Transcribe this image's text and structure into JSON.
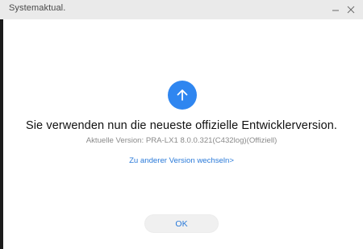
{
  "window": {
    "title": "Systemaktual."
  },
  "icons": {
    "update": "arrow-up-icon",
    "minimize": "minimize-icon",
    "close": "close-icon"
  },
  "main": {
    "headline": "Sie verwenden nun die neueste offizielle Entwicklerversion.",
    "version_text": "Aktuelle Version: PRA-LX1 8.0.0.321(C432log)(Offiziell)",
    "switch_link": "Zu anderer Version wechseln>",
    "ok_label": "OK"
  },
  "colors": {
    "accent": "#2a7ad9",
    "icon_circle": "#2f86f0",
    "titlebar": "#eaeaea"
  }
}
